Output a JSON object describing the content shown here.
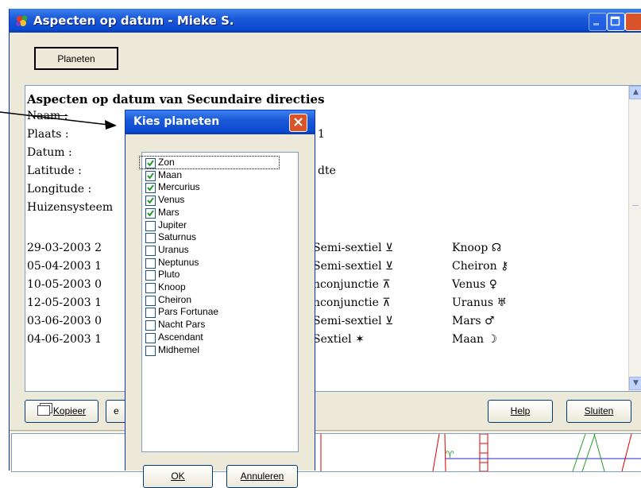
{
  "window": {
    "title": "Aspecten op datum - Mieke S."
  },
  "toolbar": {
    "planeten_label": "Planeten"
  },
  "report": {
    "heading": "Aspecten op datum van Secundaire directies",
    "fields": {
      "naam": "Naam :",
      "plaats": "Plaats :",
      "datum": "Datum :",
      "latitude": "Latitude :",
      "longitude": "Longitude :",
      "huizen": "Huizensysteem",
      "latitude_value_fragment": "dte",
      "plaats_value_fragment": "1"
    },
    "aspects": [
      {
        "date": "29-03-2003 2",
        "aspect": "Semi-sextiel ⊻",
        "target": "Knoop ☊"
      },
      {
        "date": "05-04-2003 1",
        "aspect": "Semi-sextiel ⊻",
        "target": "Cheiron ⚷"
      },
      {
        "date": "10-05-2003 0",
        "aspect": "nconjunctie ⊼",
        "target": "Venus ♀"
      },
      {
        "date": "12-05-2003 1",
        "aspect": "nconjunctie ⊼",
        "target": "Uranus ♅"
      },
      {
        "date": "03-06-2003 0",
        "aspect": "Semi-sextiel ⊻",
        "target": "Mars ♂"
      },
      {
        "date": "04-06-2003 1",
        "aspect": "Sextiel ✶",
        "target": "Maan ☽"
      }
    ]
  },
  "buttons": {
    "kopieer": "Kopieer",
    "e_fragment": "e",
    "help": "Help",
    "sluiten": "Sluiten"
  },
  "dialog": {
    "title": "Kies planeten",
    "ok": "OK",
    "annuleren": "Annuleren",
    "planets": [
      {
        "label": "Zon",
        "checked": true
      },
      {
        "label": "Maan",
        "checked": true
      },
      {
        "label": "Mercurius",
        "checked": true
      },
      {
        "label": "Venus",
        "checked": true
      },
      {
        "label": "Mars",
        "checked": true
      },
      {
        "label": "Jupiter",
        "checked": false
      },
      {
        "label": "Saturnus",
        "checked": false
      },
      {
        "label": "Uranus",
        "checked": false
      },
      {
        "label": "Neptunus",
        "checked": false
      },
      {
        "label": "Pluto",
        "checked": false
      },
      {
        "label": "Knoop",
        "checked": false
      },
      {
        "label": "Cheiron",
        "checked": false
      },
      {
        "label": "Pars Fortunae",
        "checked": false
      },
      {
        "label": "Nacht Pars",
        "checked": false
      },
      {
        "label": "Ascendant",
        "checked": false
      },
      {
        "label": "Midhemel",
        "checked": false
      }
    ]
  },
  "colors": {
    "titlebar": "#0a4bd0",
    "window_bg": "#ece9d8",
    "close_red": "#d9542b"
  }
}
